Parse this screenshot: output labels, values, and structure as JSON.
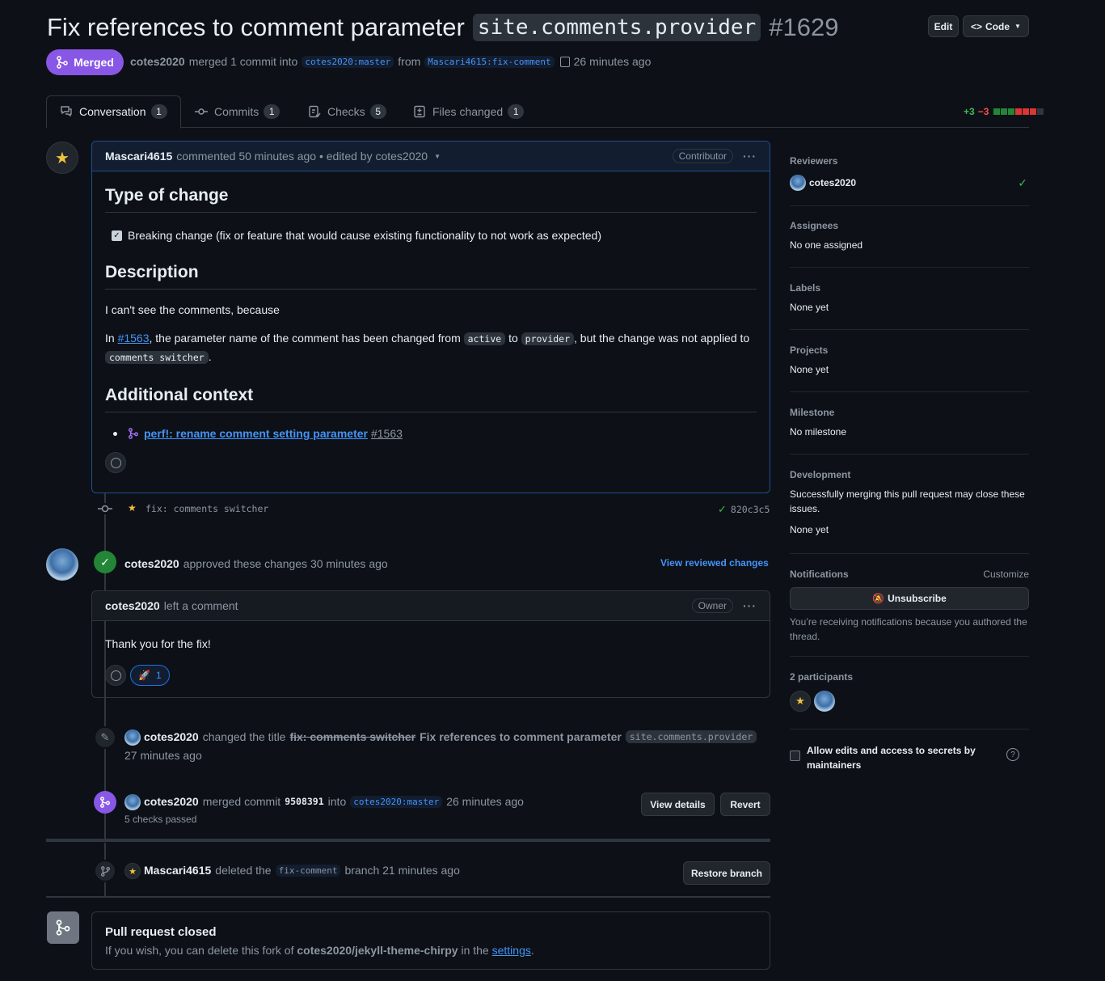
{
  "pr": {
    "title_text": "Fix references to comment parameter",
    "title_code": "site.comments.provider",
    "number": "#1629",
    "edit_label": "Edit",
    "code_label": "Code",
    "state_label": "Merged",
    "meta": {
      "author": "cotes2020",
      "action": "merged 1 commit into",
      "base": "cotes2020:master",
      "from": "from",
      "head": "Mascari4615:fix-comment",
      "time": "26 minutes ago"
    }
  },
  "tabs": [
    {
      "label": "Conversation",
      "count": "1"
    },
    {
      "label": "Commits",
      "count": "1"
    },
    {
      "label": "Checks",
      "count": "5"
    },
    {
      "label": "Files changed",
      "count": "1"
    }
  ],
  "diffstat": {
    "additions": "+3",
    "deletions": "−3"
  },
  "first_comment": {
    "author": "Mascari4615",
    "meta": "commented 50 minutes ago • edited by cotes2020",
    "badge": "Contributor",
    "h_type": "Type of change",
    "checkbox_label": "Breaking change (fix or feature that would cause existing functionality to not work as expected)",
    "h_desc": "Description",
    "p1": "I can't see the comments, because",
    "p2_a": "In",
    "p2_link": "#1563",
    "p2_b": ", the parameter name of the comment has been changed from",
    "p2_code1": "active",
    "p2_c": "to",
    "p2_code2": "provider",
    "p2_d": ", but the change was not applied to",
    "p2_code3": "comments switcher",
    "p2_e": ".",
    "h_ctx": "Additional context",
    "ref_link": "perf!: rename comment setting parameter",
    "ref_num": "#1563"
  },
  "commit": {
    "message": "fix: comments switcher",
    "sha": "820c3c5"
  },
  "review": {
    "author": "cotes2020",
    "action": "approved these changes 30 minutes ago",
    "view_link": "View reviewed changes",
    "comment_author": "cotes2020",
    "comment_meta": "left a comment",
    "badge": "Owner",
    "body": "Thank you for the fix!",
    "reaction_count": "1"
  },
  "rename_event": {
    "author": "cotes2020",
    "action": "changed the title",
    "old_title": "fix: comments switcher",
    "new_title": "Fix references to comment parameter",
    "new_code": "site.comments.provider",
    "time": "27 minutes ago"
  },
  "merge_event": {
    "author": "cotes2020",
    "action": "merged commit",
    "sha": "9508391",
    "into": "into",
    "branch": "cotes2020:master",
    "time": "26 minutes ago",
    "checks": "5 checks passed",
    "view_details": "View details",
    "revert": "Revert"
  },
  "delete_event": {
    "author": "Mascari4615",
    "action": "deleted the",
    "branch": "fix-comment",
    "after": "branch 21 minutes ago",
    "restore": "Restore branch"
  },
  "closed": {
    "title": "Pull request closed",
    "text_a": "If you wish, you can delete this fork of",
    "repo": "cotes2020/jekyll-theme-chirpy",
    "text_b": "in the",
    "settings": "settings",
    "text_c": "."
  },
  "sidebar": {
    "reviewers_h": "Reviewers",
    "reviewer": "cotes2020",
    "assignees_h": "Assignees",
    "assignees_v": "No one assigned",
    "labels_h": "Labels",
    "labels_v": "None yet",
    "projects_h": "Projects",
    "projects_v": "None yet",
    "milestone_h": "Milestone",
    "milestone_v": "No milestone",
    "development_h": "Development",
    "development_text": "Successfully merging this pull request may close these issues.",
    "development_v": "None yet",
    "notifications_h": "Notifications",
    "customize": "Customize",
    "unsubscribe": "Unsubscribe",
    "notif_text": "You’re receiving notifications because you authored the thread.",
    "participants_h": "2 participants",
    "allow_edits": "Allow edits and access to secrets by maintainers"
  },
  "colors": {
    "merged": "#8957e5",
    "approved": "#238636",
    "link": "#4493f8",
    "addition": "#3fb950",
    "deletion": "#f85149"
  }
}
